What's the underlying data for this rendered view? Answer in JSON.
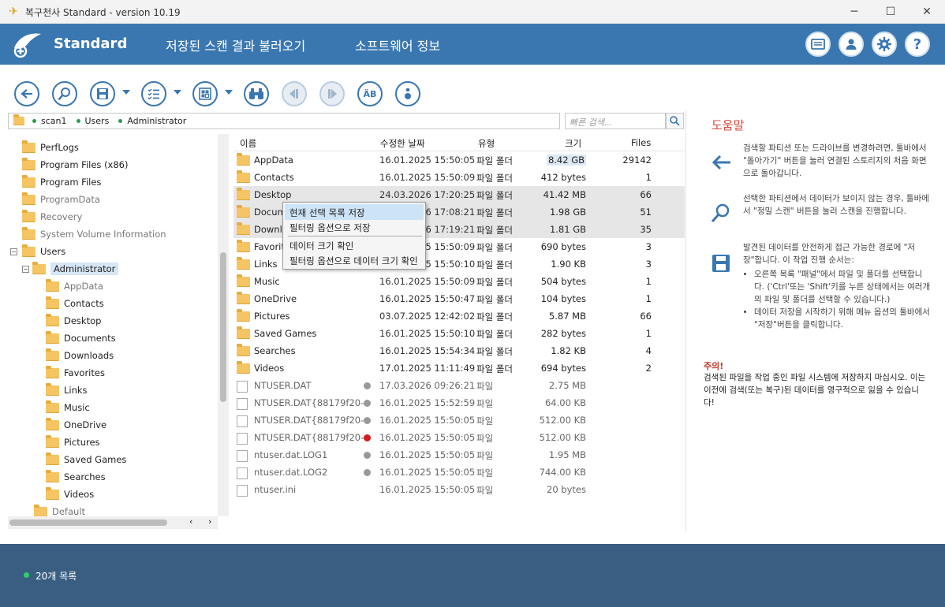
{
  "window": {
    "title": "복구천사 Standard - version 10.19"
  },
  "header": {
    "brand": "Standard",
    "nav": [
      "저장된 스캔 결과 불러오기",
      "소프트웨어 정보"
    ],
    "buttons": [
      "license-icon",
      "user-icon",
      "gear-icon",
      "help-icon"
    ]
  },
  "toolbar": {
    "buttons": [
      "back-icon",
      "deep-scan-icon",
      "save-icon",
      "list-options-icon",
      "view-icon",
      "find-icon",
      "prev-icon",
      "next-icon",
      "rename-icon",
      "info-icon"
    ]
  },
  "path": {
    "segments": [
      "scan1",
      "Users",
      "Administrator"
    ]
  },
  "search": {
    "placeholder": "빠른 검색..."
  },
  "tree": {
    "items": [
      {
        "label": "PerfLogs"
      },
      {
        "label": "Program Files (x86)"
      },
      {
        "label": "Program Files"
      },
      {
        "label": "ProgramData"
      },
      {
        "label": "Recovery"
      },
      {
        "label": "System Volume Information"
      },
      {
        "label": "Users"
      },
      {
        "label": "Administrator"
      },
      {
        "label": "AppData"
      },
      {
        "label": "Contacts"
      },
      {
        "label": "Desktop"
      },
      {
        "label": "Documents"
      },
      {
        "label": "Downloads"
      },
      {
        "label": "Favorites"
      },
      {
        "label": "Links"
      },
      {
        "label": "Music"
      },
      {
        "label": "OneDrive"
      },
      {
        "label": "Pictures"
      },
      {
        "label": "Saved Games"
      },
      {
        "label": "Searches"
      },
      {
        "label": "Videos"
      },
      {
        "label": "Default"
      }
    ]
  },
  "list": {
    "columns": {
      "name": "이름",
      "date": "수정한 날짜",
      "type": "유형",
      "size": "크기",
      "files": "Files"
    },
    "rows": [
      {
        "name": "AppData",
        "date": "16.01.2025 15:50:05",
        "type": "파일 폴더",
        "size": "8.42 GB",
        "files": "29142"
      },
      {
        "name": "Contacts",
        "date": "16.01.2025 15:50:09",
        "type": "파일 폴더",
        "size": "412 bytes",
        "files": "1"
      },
      {
        "name": "Desktop",
        "date": "24.03.2026 17:20:25",
        "type": "파일 폴더",
        "size": "41.42 MB",
        "files": "66"
      },
      {
        "name": "Documents",
        "date": "24.03.2026 17:08:21",
        "type": "파일 폴더",
        "size": "1.98 GB",
        "files": "51"
      },
      {
        "name": "Downloads",
        "date": "24.03.2026 17:19:21",
        "type": "파일 폴더",
        "size": "1.81 GB",
        "files": "35"
      },
      {
        "name": "Favorites",
        "date": "16.01.2025 15:50:09",
        "type": "파일 폴더",
        "size": "690 bytes",
        "files": "3"
      },
      {
        "name": "Links",
        "date": "16.01.2025 15:50:10",
        "type": "파일 폴더",
        "size": "1.90 KB",
        "files": "3"
      },
      {
        "name": "Music",
        "date": "16.01.2025 15:50:09",
        "type": "파일 폴더",
        "size": "504 bytes",
        "files": "1"
      },
      {
        "name": "OneDrive",
        "date": "16.01.2025 15:50:47",
        "type": "파일 폴더",
        "size": "104 bytes",
        "files": "1"
      },
      {
        "name": "Pictures",
        "date": "03.07.2025 12:42:02",
        "type": "파일 폴더",
        "size": "5.87 MB",
        "files": "66"
      },
      {
        "name": "Saved Games",
        "date": "16.01.2025 15:50:10",
        "type": "파일 폴더",
        "size": "282 bytes",
        "files": "1"
      },
      {
        "name": "Searches",
        "date": "16.01.2025 15:54:34",
        "type": "파일 폴더",
        "size": "1.82 KB",
        "files": "4"
      },
      {
        "name": "Videos",
        "date": "17.01.2025 11:11:49",
        "type": "파일 폴더",
        "size": "694 bytes",
        "files": "2"
      },
      {
        "name": "NTUSER.DAT",
        "date": "17.03.2026 09:26:21",
        "type": "파일",
        "size": "2.75 MB",
        "files": ""
      },
      {
        "name": "NTUSER.DAT{88179f20-d...",
        "date": "16.01.2025 15:52:59",
        "type": "파일",
        "size": "64.00 KB",
        "files": ""
      },
      {
        "name": "NTUSER.DAT{88179f20-d...",
        "date": "16.01.2025 15:50:05",
        "type": "파일",
        "size": "512.00 KB",
        "files": ""
      },
      {
        "name": "NTUSER.DAT{88179f20-d...",
        "date": "16.01.2025 15:50:05",
        "type": "파일",
        "size": "512.00 KB",
        "files": ""
      },
      {
        "name": "ntuser.dat.LOG1",
        "date": "16.01.2025 15:50:05",
        "type": "파일",
        "size": "1.95 MB",
        "files": ""
      },
      {
        "name": "ntuser.dat.LOG2",
        "date": "16.01.2025 15:50:05",
        "type": "파일",
        "size": "744.00 KB",
        "files": ""
      },
      {
        "name": "ntuser.ini",
        "date": "16.01.2025 15:50:05",
        "type": "파일",
        "size": "20 bytes",
        "files": ""
      }
    ]
  },
  "context_menu": {
    "items": [
      "현재 선택 목록 저장",
      "필터링 옵션으로 저장",
      "데이터 크기 확인",
      "필터링 옵션으로 데이터 크기 확인"
    ]
  },
  "help": {
    "title": "도움말",
    "block1": "검색할 파티션 또는 드라이브를 변경하려면, 툴바에서 \"돌아가기\" 버튼을 눌러 연결된 스토리지의 처음 화면으로 돌아갑니다.",
    "block2": "선택한 파티션에서 데이터가 보이지 않는 경우, 툴바에서 \"정밀 스캔\" 버튼을 눌러 스캔을 진행합니다.",
    "block3": "발견된 데이터를 안전하게 접근 가능한 경로에 \"저장\"합니다. 이 작업 진행 순서는:",
    "bullet1": "오른쪽 목록 \"패널\"에서 파일 및 폴더를 선택합니다. ('Ctrl'또는 'Shift'키를 누른 상태에서는 여러개의 파일 및 폴더를 선택할 수 있습니다.)",
    "bullet2": "데이터 저장을 시작하기 위해 메뉴 옵션의 툴바에서 \"저장\"버튼을 클릭합니다.",
    "warn_title": "주의!",
    "warn_body": "검색된 파일을 작업 중인 파일 시스템에 저장하지 마십시오. 이는 이전에 검색(또는 복구)된 데이터를 영구적으로 잃을 수 있습니다!"
  },
  "status": {
    "text": "20개 목록"
  }
}
